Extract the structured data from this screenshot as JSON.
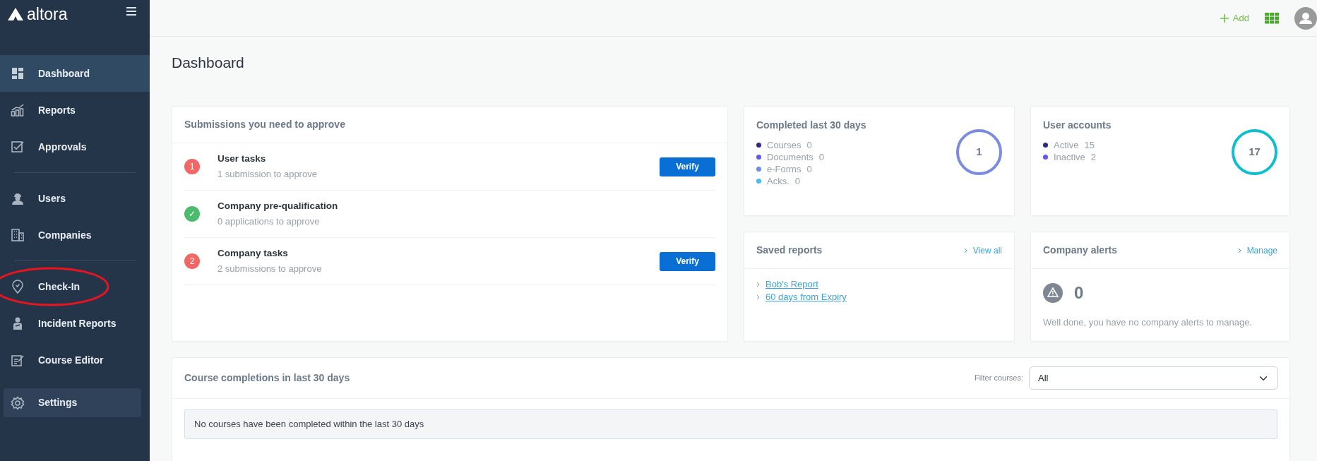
{
  "app": {
    "logo": "altora"
  },
  "sidebar": {
    "groups": [
      {
        "items": [
          {
            "label": "Dashboard",
            "selected": true,
            "circled": false
          },
          {
            "label": "Reports",
            "selected": false,
            "circled": false
          },
          {
            "label": "Approvals",
            "selected": false,
            "circled": false
          }
        ]
      },
      {
        "items": [
          {
            "label": "Users",
            "selected": false,
            "circled": false
          },
          {
            "label": "Companies",
            "selected": false,
            "circled": false
          }
        ]
      },
      {
        "items": [
          {
            "label": "Check-In",
            "selected": false,
            "circled": true
          },
          {
            "label": "Incident Reports",
            "selected": false,
            "circled": false
          },
          {
            "label": "Course Editor",
            "selected": false,
            "circled": false
          }
        ]
      }
    ],
    "settings": {
      "label": "Settings",
      "selected": false,
      "circled": false
    }
  },
  "topbar": {
    "add_label": "Add"
  },
  "page_title": "Dashboard",
  "submissions": {
    "title": "Submissions you need to approve",
    "rows": [
      {
        "badge": "1",
        "color": "#f26666",
        "title": "User tasks",
        "subtitle": "1 submission to approve",
        "action": "Verify"
      },
      {
        "badge": "✓",
        "color": "#4cbb6c",
        "title": "Company pre-qualification",
        "subtitle": "0 applications to approve"
      },
      {
        "badge": "2",
        "color": "#f26666",
        "title": "Company tasks",
        "subtitle": "2 submissions to approve",
        "action": "Verify"
      }
    ]
  },
  "completed": {
    "title": "Completed last 30 days",
    "items": [
      {
        "label": "Courses",
        "value": "0",
        "color": "#2e2a8a"
      },
      {
        "label": "Documents",
        "value": "0",
        "color": "#6456f0"
      },
      {
        "label": "e-Forms",
        "value": "0",
        "color": "#6a8bf0"
      },
      {
        "label": "Acks.",
        "value": "0",
        "color": "#3fc0f0"
      }
    ],
    "total": "1"
  },
  "user_accounts": {
    "title": "User accounts",
    "items": [
      {
        "label": "Active",
        "value": "15",
        "color": "#2e2a8a"
      },
      {
        "label": "Inactive",
        "value": "2",
        "color": "#6456f0"
      }
    ],
    "total": "17"
  },
  "saved_reports": {
    "title": "Saved reports",
    "link": "View all",
    "reports": [
      "Bob's Report",
      "60 days from Expiry"
    ]
  },
  "company_alerts": {
    "title": "Company alerts",
    "link": "Manage",
    "count": "0",
    "message": "Well done, you have no company alerts to manage."
  },
  "course_completions": {
    "title": "Course completions in last 30 days",
    "filter_label": "Filter courses:",
    "filter_value": "All",
    "empty_message": "No courses have been completed within the last 30 days"
  }
}
